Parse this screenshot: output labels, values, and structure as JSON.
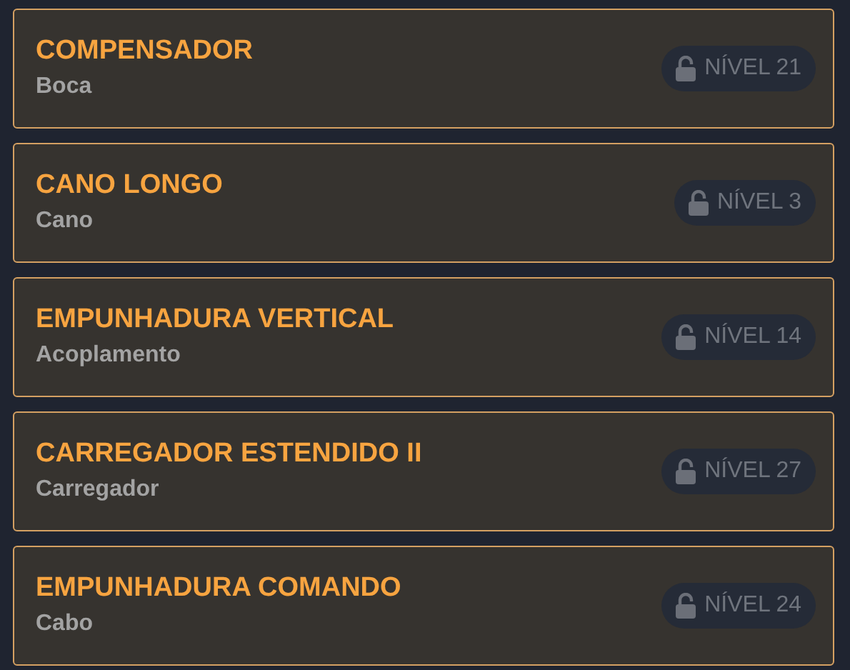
{
  "attachments": [
    {
      "name": "COMPENSADOR",
      "slot": "Boca",
      "badge": "NÍVEL 21"
    },
    {
      "name": "CANO LONGO",
      "slot": "Cano",
      "badge": "NÍVEL 3"
    },
    {
      "name": "EMPUNHADURA VERTICAL",
      "slot": "Acoplamento",
      "badge": "NÍVEL 14"
    },
    {
      "name": "CARREGADOR ESTENDIDO II",
      "slot": "Carregador",
      "badge": "NÍVEL 27"
    },
    {
      "name": "EMPUNHADURA COMANDO",
      "slot": "Cabo",
      "badge": "NÍVEL 24"
    }
  ]
}
